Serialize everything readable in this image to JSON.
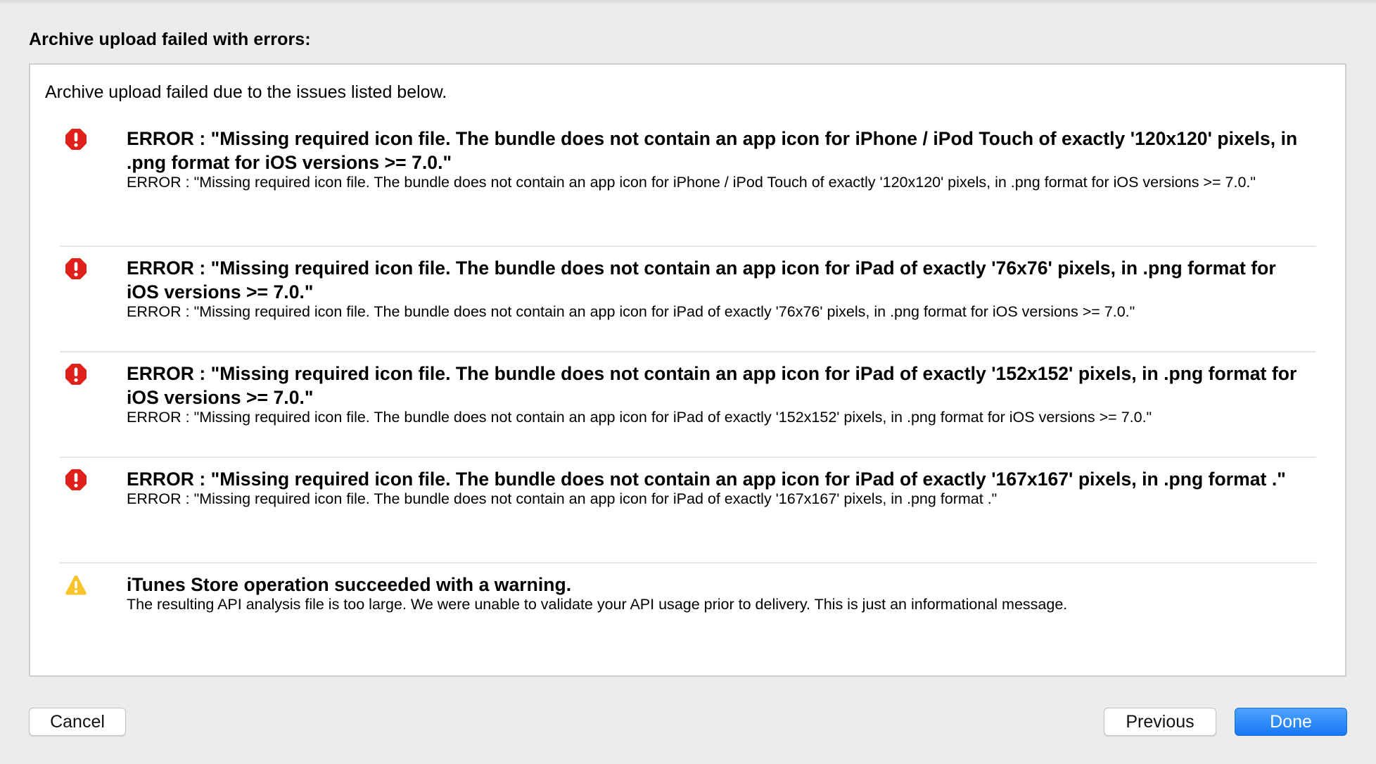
{
  "dialog": {
    "title": "Archive upload failed with errors:",
    "intro": "Archive upload failed due to the issues listed below."
  },
  "issues": [
    {
      "type": "error",
      "icon": "error-icon",
      "headline": "ERROR : \"Missing required icon file. The bundle does not contain an app icon for iPhone / iPod Touch of exactly '120x120' pixels, in .png format for iOS versions >= 7.0.\"",
      "detail": "ERROR : \"Missing required icon file. The bundle does not contain an app icon for iPhone / iPod Touch of exactly '120x120' pixels, in .png format for iOS versions >= 7.0.\""
    },
    {
      "type": "error",
      "icon": "error-icon",
      "headline": "ERROR : \"Missing required icon file. The bundle does not contain an app icon for iPad of exactly '76x76' pixels, in .png format for iOS versions >= 7.0.\"",
      "detail": "ERROR : \"Missing required icon file. The bundle does not contain an app icon for iPad of exactly '76x76' pixels, in .png format for iOS versions >= 7.0.\""
    },
    {
      "type": "error",
      "icon": "error-icon",
      "headline": "ERROR : \"Missing required icon file. The bundle does not contain an app icon for iPad of exactly '152x152' pixels, in .png format for iOS versions >= 7.0.\"",
      "detail": "ERROR : \"Missing required icon file. The bundle does not contain an app icon for iPad of exactly '152x152' pixels, in .png format for iOS versions >= 7.0.\""
    },
    {
      "type": "error",
      "icon": "error-icon",
      "headline": "ERROR : \"Missing required icon file. The bundle does not contain an app icon for iPad of exactly '167x167' pixels, in .png format .\"",
      "detail": "ERROR : \"Missing required icon file. The bundle does not contain an app icon for iPad of exactly '167x167' pixels, in .png format .\""
    },
    {
      "type": "warning",
      "icon": "warning-icon",
      "headline": "iTunes Store operation succeeded with a warning.",
      "detail": "The resulting API analysis file is too large.  We were unable to validate your API usage prior to delivery.  This is just an informational message."
    }
  ],
  "buttons": {
    "cancel": "Cancel",
    "previous": "Previous",
    "done": "Done"
  },
  "colors": {
    "error_red": "#e0201b",
    "warning_yellow": "#f7c52b",
    "primary_blue": "#1778f2",
    "window_bg": "#ececec"
  }
}
